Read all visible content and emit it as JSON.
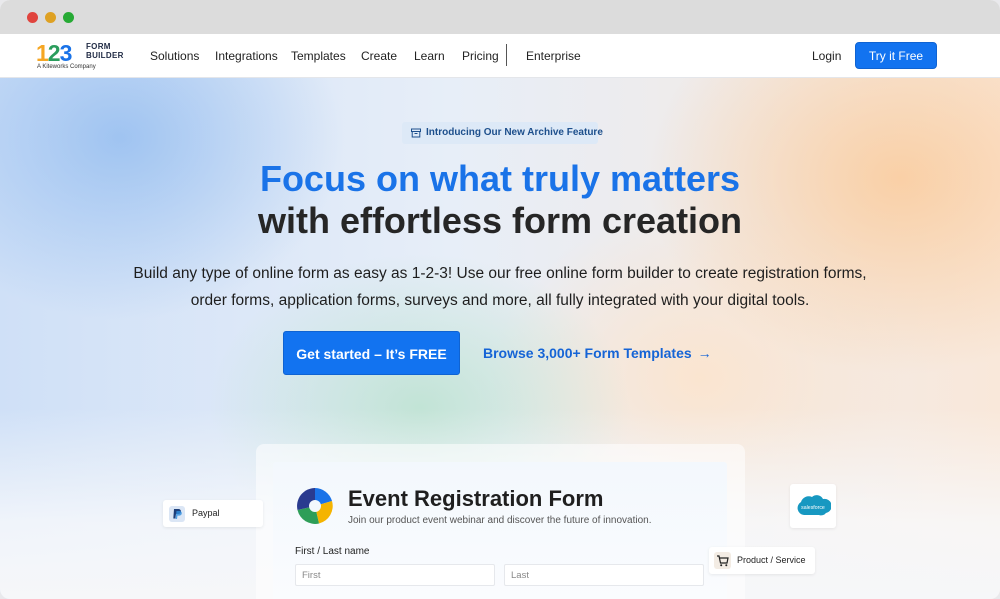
{
  "window": {
    "controls": [
      "close",
      "minimize",
      "maximize"
    ]
  },
  "nav": {
    "logo": {
      "digits": [
        "1",
        "2",
        "3"
      ],
      "text_line1": "FORM",
      "text_line2": "BUILDER",
      "tagline": "A Kiteworks Company"
    },
    "items": [
      "Solutions",
      "Integrations",
      "Templates",
      "Create",
      "Learn",
      "Pricing",
      "Enterprise"
    ],
    "login": "Login",
    "try_button": "Try it Free"
  },
  "hero": {
    "badge": {
      "icon": "archive-icon",
      "text": "Introducing Our New Archive Feature"
    },
    "headline_line1": "Focus on what truly matters",
    "headline_line2": "with effortless form creation",
    "lead_line1": "Build any type of online form as easy as 1-2-3! Use our free online form builder to create registration forms,",
    "lead_line2": "order forms, application forms, surveys and more, all fully integrated with your digital tools.",
    "cta_primary": "Get started – It’s FREE",
    "cta_secondary": "Browse 3,000+ Form Templates",
    "cta_secondary_icon": "arrow-right-icon"
  },
  "preview_form": {
    "title": "Event Registration Form",
    "subtitle": "Join our product event webinar and discover the future of innovation.",
    "field_label": "First / Last name",
    "first_placeholder": "First",
    "last_placeholder": "Last"
  },
  "integrations": {
    "paypal": "Paypal",
    "salesforce": "salesforce",
    "product": "Product / Service"
  },
  "colors": {
    "brand_blue": "#1273f0",
    "headline_blue": "#1a73e8",
    "logo_orange": "#f5a623",
    "logo_green": "#2a9d5c"
  }
}
